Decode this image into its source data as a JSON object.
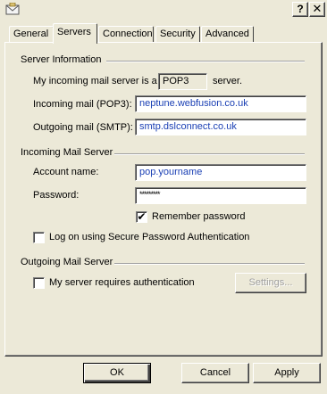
{
  "window": {
    "help_symbol": "?",
    "close_symbol": "✕"
  },
  "tabs": [
    {
      "label": "General"
    },
    {
      "label": "Servers"
    },
    {
      "label": "Connection"
    },
    {
      "label": "Security"
    },
    {
      "label": "Advanced"
    }
  ],
  "server_info": {
    "group_title": "Server Information",
    "type_prefix": "My incoming mail server is a",
    "type_value": "POP3",
    "type_suffix": "server.",
    "incoming_label": "Incoming mail (POP3):",
    "incoming_value": "neptune.webfusion.co.uk",
    "outgoing_label": "Outgoing mail (SMTP):",
    "outgoing_value": "smtp.dslconnect.co.uk"
  },
  "incoming_server": {
    "group_title": "Incoming Mail Server",
    "account_label": "Account name:",
    "account_value": "pop.yourname",
    "password_label": "Password:",
    "password_value": "*********",
    "remember_label": "Remember password",
    "remember_checked": true,
    "spa_label": "Log on using Secure Password Authentication",
    "spa_checked": false
  },
  "outgoing_server": {
    "group_title": "Outgoing Mail Server",
    "auth_label": "My server requires authentication",
    "auth_checked": false,
    "settings_label": "Settings..."
  },
  "footer": {
    "ok_label": "OK",
    "cancel_label": "Cancel",
    "apply_label": "Apply"
  },
  "check_mark": "✔"
}
